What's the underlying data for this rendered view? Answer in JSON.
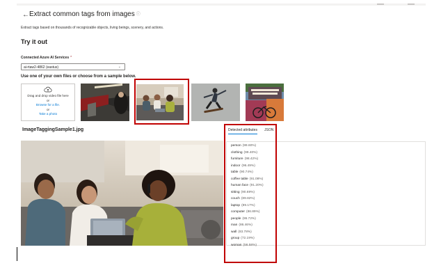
{
  "page": {
    "back_arrow": "←",
    "title": "Extract common tags from images",
    "subtitle": "Extract tags based on thousands of recognizable objects, living beings, scenery, and actions.",
    "try_it_out": "Try it out"
  },
  "service": {
    "label": "Connected Azure AI Services",
    "required_mark": "*",
    "selected": "ai-rtaw2-4862 (eastus)"
  },
  "samples": {
    "instruction": "Use one of your own files or choose from a sample below.",
    "dropzone": {
      "line1": "Drag and drop video file here",
      "or1": "or",
      "browse": "Browse for a file.",
      "or2": "or",
      "take_photo": "Take a photo"
    },
    "thumbnails": [
      {
        "name": "subway-train-sample",
        "selected": false
      },
      {
        "name": "people-meeting-sample",
        "selected": true
      },
      {
        "name": "skateboarder-sample",
        "selected": false
      },
      {
        "name": "bicycle-street-sample",
        "selected": false
      }
    ]
  },
  "result": {
    "file_name": "ImageTaggingSample1.jpg",
    "tabs": [
      {
        "label": "Detected attributes",
        "active": true
      },
      {
        "label": "JSON",
        "active": false
      }
    ],
    "attributes": [
      {
        "tag": "person",
        "confidence": "(99.60%)"
      },
      {
        "tag": "clothing",
        "confidence": "(99.40%)"
      },
      {
        "tag": "furniture",
        "confidence": "(98.42%)"
      },
      {
        "tag": "indoor",
        "confidence": "(96.49%)"
      },
      {
        "tag": "table",
        "confidence": "(90.74%)"
      },
      {
        "tag": "coffee table",
        "confidence": "(91.08%)"
      },
      {
        "tag": "human face",
        "confidence": "(91.20%)"
      },
      {
        "tag": "sitting",
        "confidence": "(90.69%)"
      },
      {
        "tag": "couch",
        "confidence": "(89.82%)"
      },
      {
        "tag": "laptop",
        "confidence": "(89.17%)"
      },
      {
        "tag": "computer",
        "confidence": "(86.89%)"
      },
      {
        "tag": "people",
        "confidence": "(86.72%)"
      },
      {
        "tag": "man",
        "confidence": "(86.46%)"
      },
      {
        "tag": "wall",
        "confidence": "(83.78%)"
      },
      {
        "tag": "group",
        "confidence": "(72.19%)"
      },
      {
        "tag": "woman",
        "confidence": "(56.58%)"
      }
    ]
  },
  "colors": {
    "accent": "#0078d4",
    "highlight": "#c00000",
    "border": "#c8c6c4"
  }
}
